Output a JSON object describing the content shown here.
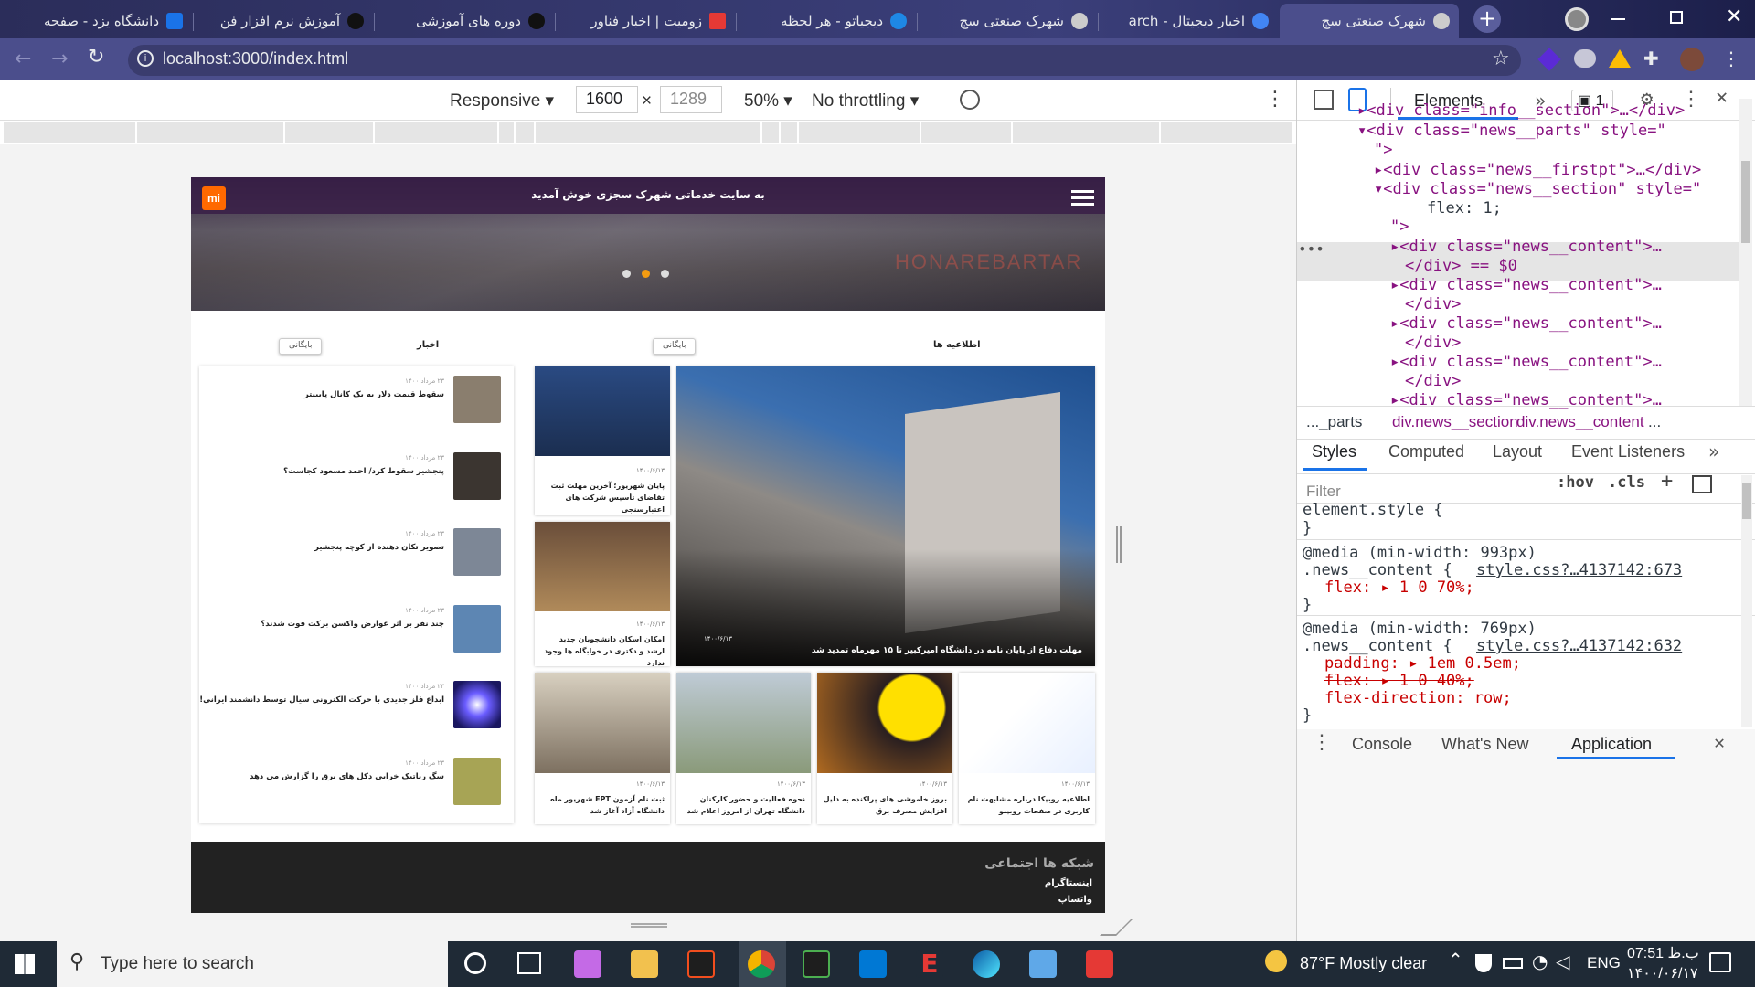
{
  "browser": {
    "tabs": [
      {
        "title": "دانشگاه یزد - صفحه",
        "color": "#1a73e8"
      },
      {
        "title": "آموزش نرم افزار فن",
        "color": "#333"
      },
      {
        "title": "دوره های آموزشی",
        "color": "#333"
      },
      {
        "title": "زومیت | اخبار فناور",
        "color": "#e53935"
      },
      {
        "title": "دیجیاتو - هر لحظه",
        "color": "#1e88e5"
      },
      {
        "title": "شهرک صنعتی سج",
        "color": "#bbb"
      },
      {
        "title": "اخبار دیجیتال - arch",
        "color": "#4285f4"
      },
      {
        "title": "شهرک صنعتی سج",
        "color": "#bbb"
      }
    ],
    "address": "localhost:3000/index.html"
  },
  "device_toolbar": {
    "mode": "Responsive",
    "width": "1600",
    "height": "1289",
    "zoom": "50%",
    "throttling": "No throttling"
  },
  "site": {
    "logo": "mi",
    "welcome": "به سایت خدماتی شهرک سجزی خوش آمدید",
    "watermark": "HONAREBARTAR",
    "announcements_heading": "اطلاعیه ها",
    "news_heading": "اخبار",
    "archive_label": "بایگانی",
    "news_items": [
      {
        "date": "۲۳ مرداد ۱۴۰۰",
        "title": "سقوط قیمت دلار به یک کانال پایینتر",
        "color": "#8a7e6e"
      },
      {
        "date": "۲۳ مرداد ۱۴۰۰",
        "title": "پنجشیر سقوط کرد/ احمد مسعود کجاست؟",
        "color": "#3b3530"
      },
      {
        "date": "۲۳ مرداد ۱۴۰۰",
        "title": "تصویر تکان دهنده از کوچه پنجشیر",
        "color": "#7d8796"
      },
      {
        "date": "۲۳ مرداد ۱۴۰۰",
        "title": "چند نفر بر اثر عوارض واکسن برکت فوت شدند؟",
        "color": "#5d86b3"
      },
      {
        "date": "۲۳ مرداد ۱۴۰۰",
        "title": "ابداع فلز جدیدی با حرکت الکترونی سیال توسط دانشمند ایرانی!",
        "color": "#4b3fd6"
      },
      {
        "date": "۲۳ مرداد ۱۴۰۰",
        "title": "سگ رباتیک خرابی دکل های برق را گزارش می دهد",
        "color": "#a7a455"
      }
    ],
    "announcements": {
      "big": {
        "date": "۱۴۰۰/۶/۱۳",
        "title": "مهلت دفاع از پایان نامه در دانشگاه امیرکبیر تا ۱۵ مهرماه تمدید شد"
      },
      "side": [
        {
          "date": "۱۴۰۰/۶/۱۳",
          "title": "پایان شهریور؛ آخرین مهلت ثبت تقاضای تأسیس شرکت های اعتبارسنجی"
        },
        {
          "date": "۱۴۰۰/۶/۱۳",
          "title": "امکان اسکان دانشجویان جدید ارشد و دکتری در خوابگاه ها وجود ندارد"
        }
      ],
      "bottom": [
        {
          "date": "۱۴۰۰/۶/۱۳",
          "title": "اطلاعیه روبیکا درباره مشابهت نام کاربری در صفحات روبینو"
        },
        {
          "date": "۱۴۰۰/۶/۱۳",
          "title": "بروز خاموشی های پراکنده به دلیل افزایش مصرف برق"
        },
        {
          "date": "۱۴۰۰/۶/۱۳",
          "title": "نحوه فعالیت و حضور کارکنان دانشگاه تهران از امروز اعلام شد"
        },
        {
          "date": "۱۴۰۰/۶/۱۳",
          "title": "ثبت نام آزمون EPT شهریور ماه دانشگاه آزاد آغاز شد"
        }
      ]
    },
    "footer": {
      "heading": "شبکه ها اجتماعی",
      "links": [
        "اینستاگرام",
        "واتساپ"
      ]
    }
  },
  "devtools": {
    "panel_tab": "Elements",
    "issues_count": "1",
    "breadcrumb": [
      "..._parts",
      "div.news__section",
      "div.news__content",
      "..."
    ],
    "style_tabs": [
      "Styles",
      "Computed",
      "Layout",
      "Event Listeners"
    ],
    "filter_placeholder": "Filter",
    "hov": ":hov",
    "cls": ".cls",
    "dom_lines": [
      {
        "tag": "<div class=\"info__section\">…</div>"
      },
      {
        "tag": "<div class=\"news__parts\" style=\""
      },
      {
        "tag": "\">"
      },
      {
        "tag": "<div class=\"news__firstpt\">…</div>"
      },
      {
        "tag": "<div class=\"news__section\" style=\""
      },
      {
        "tag": "flex: 1;"
      },
      {
        "tag": "\">"
      },
      {
        "tag": "<div class=\"news__content\">…"
      },
      {
        "tag": "</div> == $0"
      },
      {
        "tag": "<div class=\"news__content\">…"
      },
      {
        "tag": "</div>"
      },
      {
        "tag": "<div class=\"news__content\">…"
      },
      {
        "tag": "</div>"
      },
      {
        "tag": "<div class=\"news__content\">…"
      },
      {
        "tag": "</div>"
      },
      {
        "tag": "<div class=\"news__content\">…"
      }
    ],
    "css_rules": [
      {
        "selector": "element.style {",
        "close": "}"
      },
      {
        "media": "@media (min-width: 993px)",
        "selector": ".news__content {",
        "source": "style.css?…4137142:673",
        "props": [
          "flex: ▸ 1 0 70%;"
        ],
        "close": "}"
      },
      {
        "media": "@media (min-width: 769px)",
        "selector": ".news__content {",
        "source": "style.css?…4137142:632",
        "props": [
          "padding: ▸ 1em 0.5em;",
          "flex: ▸ 1 0 40%;",
          "flex-direction: row;"
        ],
        "close": "}"
      }
    ],
    "drawer_tabs": [
      "Console",
      "What's New",
      "Application"
    ]
  },
  "taskbar": {
    "search_placeholder": "Type here to search",
    "weather": "87°F  Mostly clear",
    "lang": "ENG",
    "time": "07:51 ب.ظ",
    "date": "۱۴۰۰/۰۶/۱۷"
  }
}
